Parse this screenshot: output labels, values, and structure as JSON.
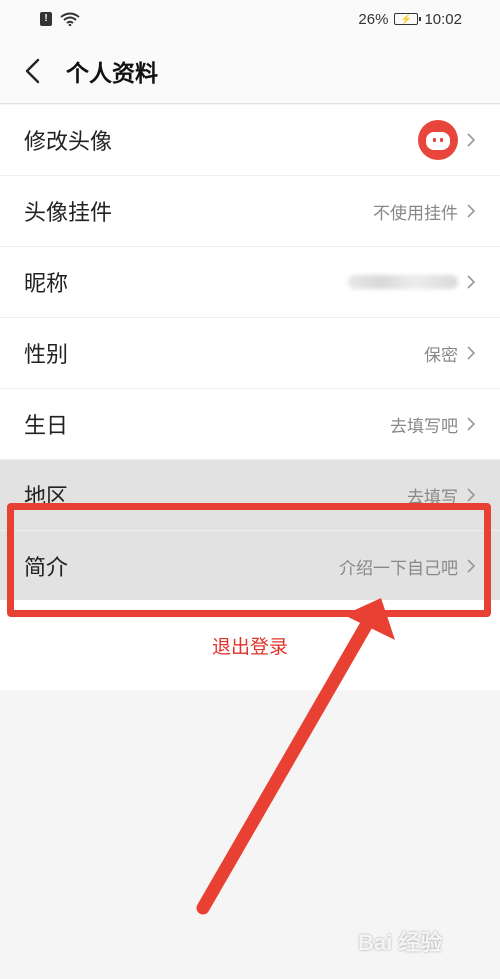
{
  "status_bar": {
    "battery_percent": "26%",
    "time": "10:02",
    "icons": [
      "sim-alert-icon",
      "wifi-icon",
      "battery-charging-icon"
    ]
  },
  "header": {
    "title": "个人资料",
    "back_icon": "chevron-left-icon"
  },
  "rows": [
    {
      "label": "修改头像",
      "value": "",
      "icon": "avatar-image"
    },
    {
      "label": "头像挂件",
      "value": "不使用挂件"
    },
    {
      "label": "昵称",
      "value": ""
    },
    {
      "label": "性别",
      "value": "保密"
    },
    {
      "label": "生日",
      "value": "去填写吧"
    },
    {
      "label": "地区",
      "value": "去填写"
    },
    {
      "label": "简介",
      "value": "介绍一下自己吧"
    }
  ],
  "logout": {
    "label": "退出登录"
  },
  "colors": {
    "accent_red": "#e0342b",
    "annotation_red": "#e84033",
    "text": "#222222",
    "secondary_text": "#888888"
  },
  "watermark": {
    "text": "Bai 经验"
  }
}
